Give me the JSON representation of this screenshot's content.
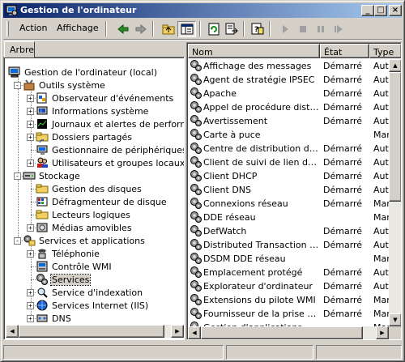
{
  "window": {
    "title": "Gestion de l'ordinateur",
    "minimize": "_",
    "maximize": "□",
    "close": "×"
  },
  "menu": {
    "action": "Action",
    "view": "Affichage"
  },
  "toolbar": [
    "back-icon",
    "forward-icon",
    "up-folder-icon",
    "show-hide-tree-icon",
    "refresh-icon",
    "export-list-icon",
    "help-icon",
    "play-icon",
    "stop-icon",
    "pause-icon",
    "restart-icon"
  ],
  "tree": {
    "tab": "Arbre",
    "items": [
      {
        "label": "Gestion de l'ordinateur (local)",
        "icon": "computer-icon",
        "selected": false
      },
      {
        "label": "Outils système",
        "icon": "system-tools-icon",
        "selected": false
      },
      {
        "label": "Observateur d'événements",
        "icon": "event-viewer-icon",
        "selected": false
      },
      {
        "label": "Informations système",
        "icon": "system-info-icon",
        "selected": false
      },
      {
        "label": "Journaux et alertes de performance",
        "icon": "performance-logs-icon",
        "selected": false
      },
      {
        "label": "Dossiers partagés",
        "icon": "shared-folders-icon",
        "selected": false
      },
      {
        "label": "Gestionnaire de périphériques",
        "icon": "device-manager-icon",
        "selected": false
      },
      {
        "label": "Utilisateurs et groupes locaux",
        "icon": "users-groups-icon",
        "selected": false
      },
      {
        "label": "Stockage",
        "icon": "storage-icon",
        "selected": false
      },
      {
        "label": "Gestion des disques",
        "icon": "disk-management-icon",
        "selected": false
      },
      {
        "label": "Défragmenteur de disque",
        "icon": "defrag-icon",
        "selected": false
      },
      {
        "label": "Lecteurs logiques",
        "icon": "logical-drives-icon",
        "selected": false
      },
      {
        "label": "Médias amovibles",
        "icon": "removable-media-icon",
        "selected": false
      },
      {
        "label": "Services et applications",
        "icon": "services-apps-icon",
        "selected": false
      },
      {
        "label": "Téléphonie",
        "icon": "telephony-icon",
        "selected": false
      },
      {
        "label": "Contrôle WMI",
        "icon": "wmi-control-icon",
        "selected": false
      },
      {
        "label": "Services",
        "icon": "services-icon",
        "selected": true
      },
      {
        "label": "Service d'indexation",
        "icon": "indexing-service-icon",
        "selected": false
      },
      {
        "label": "Services Internet (IIS)",
        "icon": "iis-icon",
        "selected": false
      },
      {
        "label": "DNS",
        "icon": "dns-icon",
        "selected": false
      }
    ]
  },
  "list": {
    "columns": [
      "Nom",
      "État",
      "Type"
    ],
    "rows": [
      [
        "Affichage des messages",
        "Démarré",
        "Auto"
      ],
      [
        "Agent de stratégie IPSEC",
        "Démarré",
        "Auto"
      ],
      [
        "Apache",
        "Démarré",
        "Auto"
      ],
      [
        "Appel de procédure distan...",
        "Démarré",
        "Auto"
      ],
      [
        "Avertissement",
        "Démarré",
        "Auto"
      ],
      [
        "Carte à puce",
        "",
        "Man"
      ],
      [
        "Centre de distribution de c...",
        "Démarré",
        "Auto"
      ],
      [
        "Client de suivi de lien distri...",
        "Démarré",
        "Auto"
      ],
      [
        "Client DHCP",
        "Démarré",
        "Auto"
      ],
      [
        "Client DNS",
        "Démarré",
        "Auto"
      ],
      [
        "Connexions réseau",
        "Démarré",
        "Man"
      ],
      [
        "DDE réseau",
        "",
        "Man"
      ],
      [
        "DefWatch",
        "Démarré",
        "Auto"
      ],
      [
        "Distributed Transaction Co...",
        "Démarré",
        "Auto"
      ],
      [
        "DSDM DDE réseau",
        "",
        "Man"
      ],
      [
        "Emplacement protégé",
        "Démarré",
        "Auto"
      ],
      [
        "Explorateur d'ordinateur",
        "Démarré",
        "Auto"
      ],
      [
        "Extensions du pilote WMI",
        "Démarré",
        "Man"
      ],
      [
        "Fournisseur de la prise en ...",
        "Démarré",
        "Man"
      ],
      [
        "Gestion d'applications",
        "",
        "Man"
      ]
    ]
  }
}
